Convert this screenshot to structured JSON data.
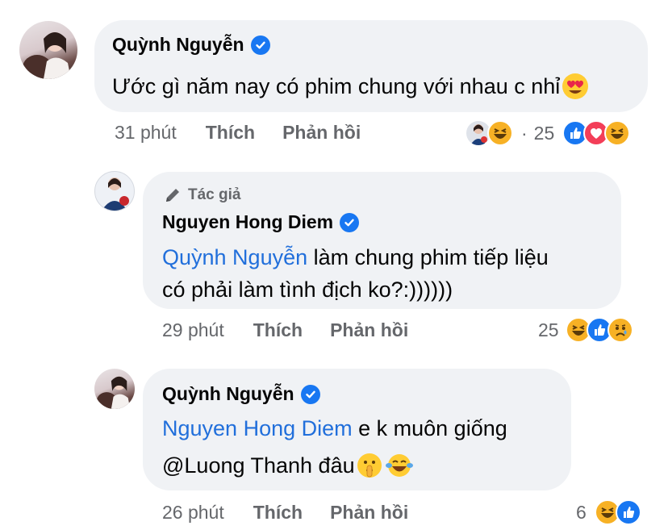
{
  "comments": [
    {
      "author": "Quỳnh Nguyễn",
      "text": "Ước gì năm nay có phim chung với nhau c nhỉ",
      "time": "31 phút",
      "like": "Thích",
      "reply": "Phản hồi",
      "reaction_count": "25",
      "replier_separator": "·",
      "reactions": [
        "like-icon",
        "love-icon",
        "haha-icon"
      ],
      "replier_reactions": [
        "haha-icon"
      ]
    },
    {
      "badge": "Tác giả",
      "author": "Nguyen Hong Diem",
      "mention": "Quỳnh Nguyễn",
      "text_line1": " làm chung phim tiếp liệu",
      "text_line2": "có phải làm tình địch ko?:))))))",
      "time": "29 phút",
      "like": "Thích",
      "reply": "Phản hồi",
      "reaction_count": "25",
      "reactions": [
        "haha-icon",
        "like-icon",
        "sad-icon"
      ]
    },
    {
      "author": "Quỳnh Nguyễn",
      "mention": "Nguyen Hong Diem",
      "text_line1": " e k muôn giống",
      "text_line2": "@Luong Thanh đâu",
      "time": "26 phút",
      "like": "Thích",
      "reply": "Phản hồi",
      "reaction_count": "6",
      "reactions": [
        "haha-icon",
        "like-icon"
      ]
    }
  ],
  "colors": {
    "bubble": "#f0f2f5",
    "mention": "#216fdb",
    "meta": "#65676b",
    "verified": "#1877f2",
    "like": "#1877f2",
    "love": "#f33e58",
    "haha": "#f7b125"
  }
}
